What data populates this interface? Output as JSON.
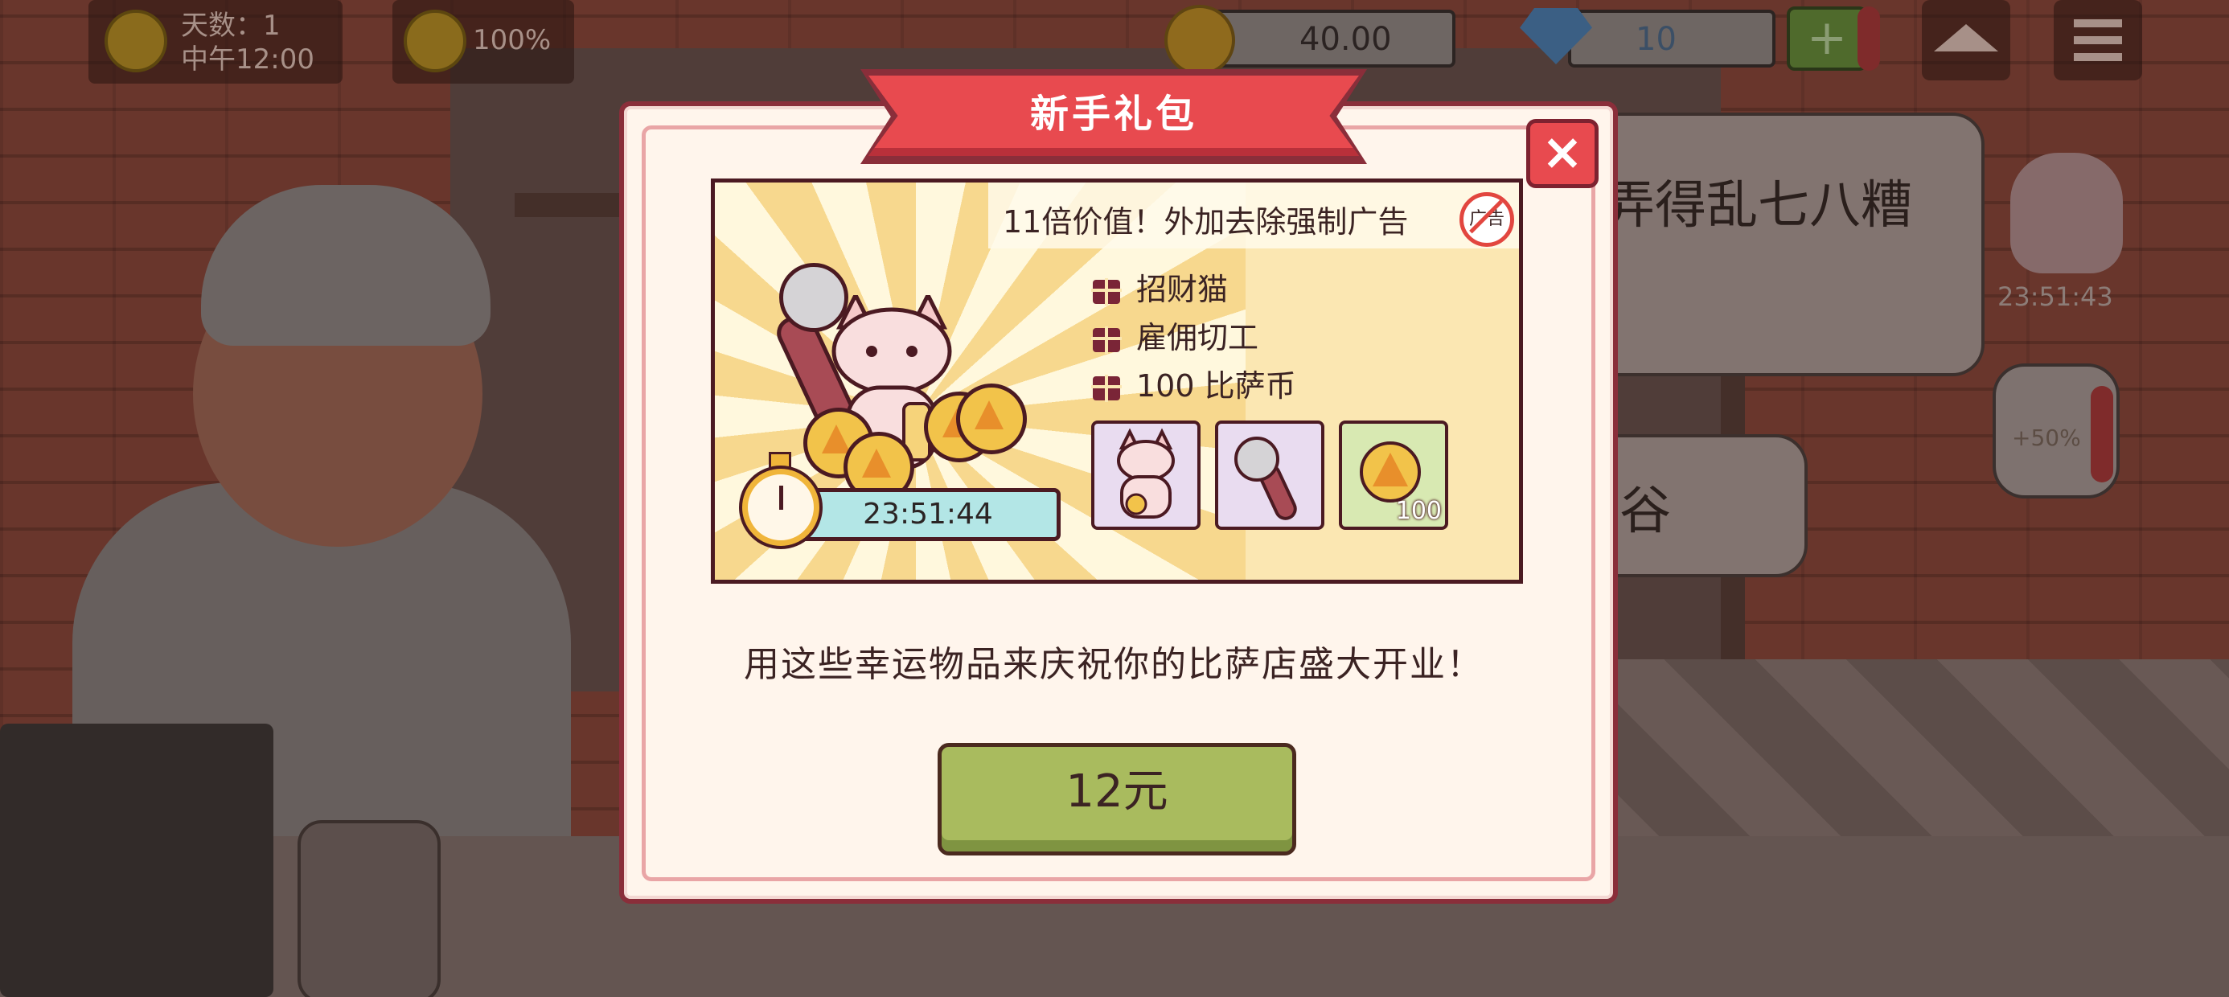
{
  "hud": {
    "day_label": "天数：1",
    "time_label": "中午12:00",
    "happiness": "100%",
    "coins": "40.00",
    "gems": "10",
    "add_label": "+"
  },
  "side": {
    "banner_text": "弄得乱七八糟",
    "banner2_text": "谷",
    "timer": "23:51:43",
    "jar_bonus": "+50%"
  },
  "modal": {
    "title": "新手礼包",
    "close_label": "×",
    "headline": "11倍价值！外加去除强制广告",
    "no_ad_label": "广告",
    "items": [
      {
        "label": "招财猫"
      },
      {
        "label": "雇佣切工"
      },
      {
        "label": "100  比萨币"
      }
    ],
    "coin_count": "100",
    "timer": "23:51:44",
    "tagline": "用这些幸运物品来庆祝你的比萨店盛大开业！",
    "buy_label": "12元"
  },
  "colors": {
    "ribbon": "#e84a4f",
    "button": "#a9bb5e",
    "timer_bar": "#b3e6e6",
    "card_bg": "#fbe7b2"
  }
}
